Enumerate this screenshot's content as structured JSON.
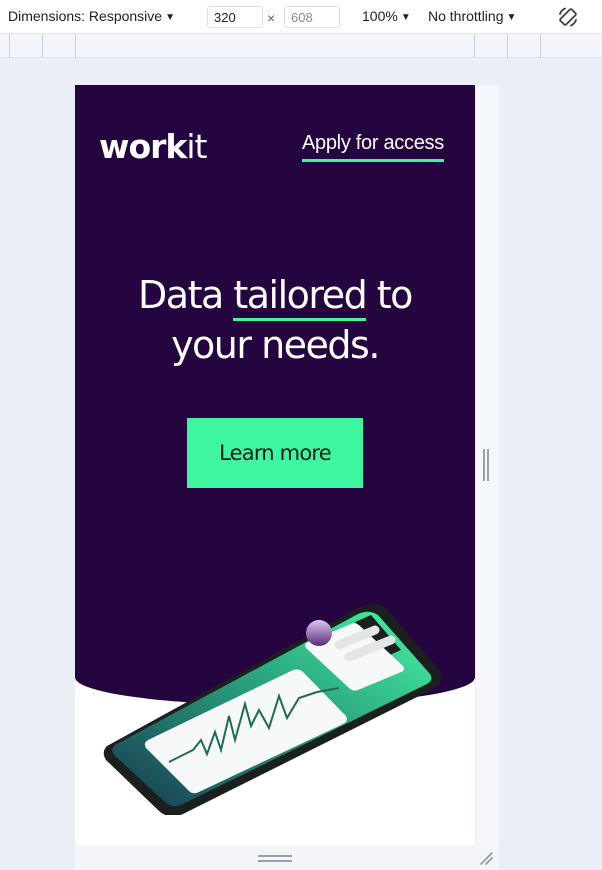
{
  "toolbar": {
    "dimensions_label": "Dimensions: Responsive",
    "width_value": "320",
    "height_placeholder": "608",
    "times_symbol": "×",
    "zoom_label": "100%",
    "throttling_label": "No throttling",
    "caret": "▼",
    "icons": [
      "chevron-down-icon",
      "rotate-icon"
    ]
  },
  "page": {
    "logo_bold": "work",
    "logo_light": "it",
    "apply_link": "Apply for access",
    "headline_before": "Data ",
    "headline_highlight": "tailored",
    "headline_after_line1": " to",
    "headline_line2": "your needs.",
    "cta_label": "Learn more"
  },
  "colors": {
    "hero_background": "#25053f",
    "accent_green": "#3ef5a0",
    "devtools_background": "#eceef5"
  }
}
